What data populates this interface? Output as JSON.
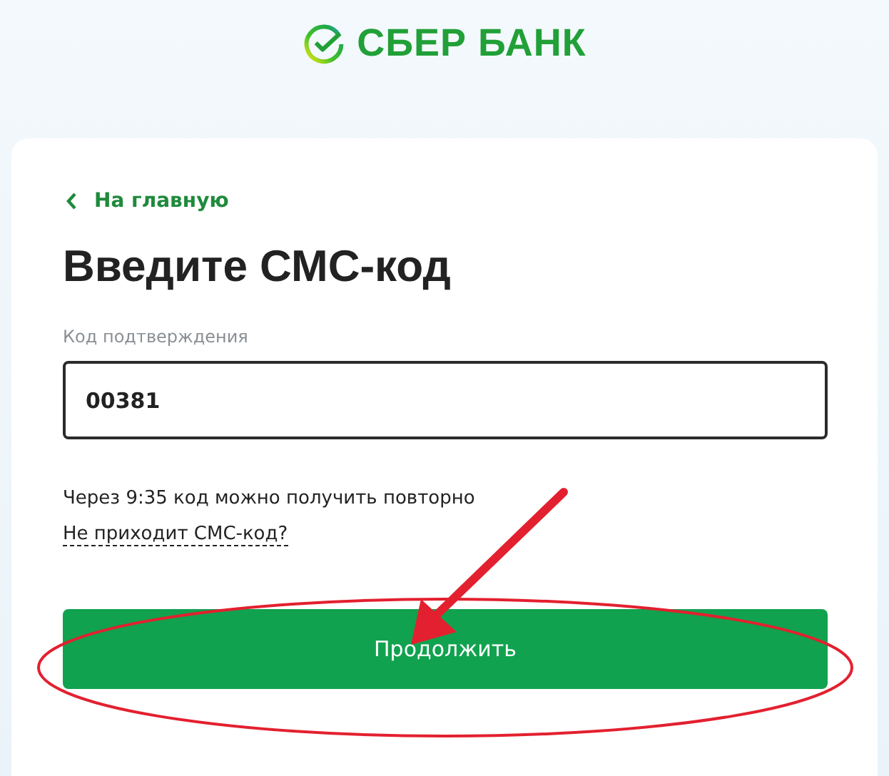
{
  "logo": {
    "text": "СБЕР БАНК"
  },
  "back_link": {
    "label": "На главную"
  },
  "title": "Введите СМС-код",
  "code_field": {
    "label": "Код подтверждения",
    "value": "00381"
  },
  "resend_note": "Через 9:35 код можно получить повторно",
  "help_link": "Не приходит СМС-код?",
  "continue_button": {
    "label": "Продолжить"
  }
}
